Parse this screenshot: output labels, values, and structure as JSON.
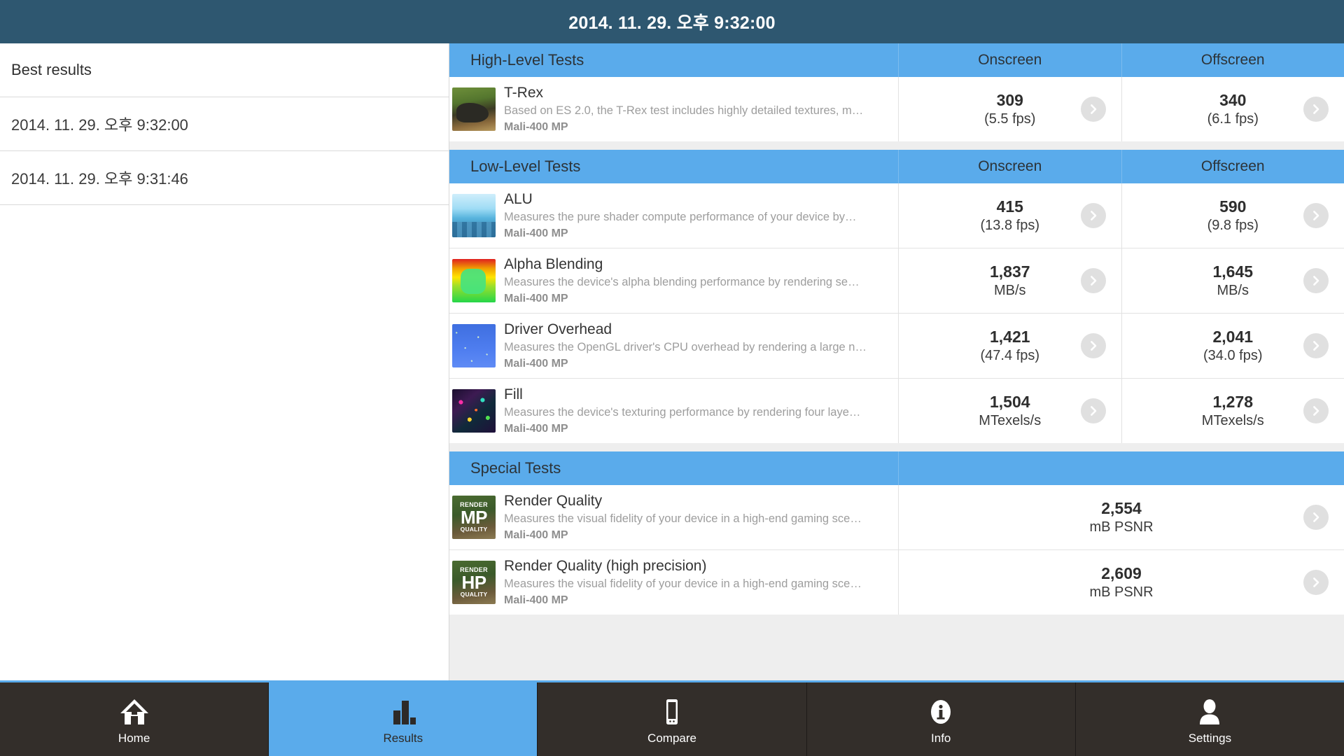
{
  "titlebar": {
    "title": "2014. 11. 29. 오후 9:32:00"
  },
  "sidebar": {
    "header": "Best results",
    "items": [
      {
        "label": "2014. 11. 29. 오후 9:32:00"
      },
      {
        "label": "2014. 11. 29. 오후 9:31:46"
      }
    ]
  },
  "columns": {
    "onscreen": "Onscreen",
    "offscreen": "Offscreen"
  },
  "sections": [
    {
      "title": "High-Level Tests",
      "rows": [
        {
          "name": "T-Rex",
          "desc": "Based on ES 2.0, the T-Rex test includes highly detailed textures, m…",
          "gpu": "Mali-400 MP",
          "thumb": "trex-thumbnail",
          "onscreen": {
            "value": "309",
            "unit": "(5.5 fps)"
          },
          "offscreen": {
            "value": "340",
            "unit": "(6.1 fps)"
          }
        }
      ]
    },
    {
      "title": "Low-Level Tests",
      "rows": [
        {
          "name": "ALU",
          "desc": "Measures the pure shader compute performance of your device by…",
          "gpu": "Mali-400 MP",
          "thumb": "alu-thumbnail",
          "onscreen": {
            "value": "415",
            "unit": "(13.8 fps)"
          },
          "offscreen": {
            "value": "590",
            "unit": "(9.8 fps)"
          }
        },
        {
          "name": "Alpha Blending",
          "desc": "Measures the device's alpha blending performance by rendering se…",
          "gpu": "Mali-400 MP",
          "thumb": "alpha-blending-thumbnail",
          "onscreen": {
            "value": "1,837",
            "unit": "MB/s"
          },
          "offscreen": {
            "value": "1,645",
            "unit": "MB/s"
          }
        },
        {
          "name": "Driver Overhead",
          "desc": "Measures the OpenGL driver's CPU overhead by rendering a large n…",
          "gpu": "Mali-400 MP",
          "thumb": "driver-overhead-thumbnail",
          "onscreen": {
            "value": "1,421",
            "unit": "(47.4 fps)"
          },
          "offscreen": {
            "value": "2,041",
            "unit": "(34.0 fps)"
          }
        },
        {
          "name": "Fill",
          "desc": "Measures the device's texturing performance by rendering four laye…",
          "gpu": "Mali-400 MP",
          "thumb": "fill-thumbnail",
          "onscreen": {
            "value": "1,504",
            "unit": "MTexels/s"
          },
          "offscreen": {
            "value": "1,278",
            "unit": "MTexels/s"
          }
        }
      ]
    },
    {
      "title": "Special Tests",
      "rows": [
        {
          "name": "Render Quality",
          "desc": "Measures the visual fidelity of your device in a high-end gaming sce…",
          "gpu": "Mali-400 MP",
          "thumb": "render-quality-mp-thumbnail",
          "badge": {
            "top": "RENDER",
            "mid": "MP",
            "bottom": "QUALITY"
          },
          "single": {
            "value": "2,554",
            "unit": "mB PSNR"
          }
        },
        {
          "name": "Render Quality (high precision)",
          "desc": "Measures the visual fidelity of your device in a high-end gaming sce…",
          "gpu": "Mali-400 MP",
          "thumb": "render-quality-hp-thumbnail",
          "badge": {
            "top": "RENDER",
            "mid": "HP",
            "bottom": "QUALITY"
          },
          "single": {
            "value": "2,609",
            "unit": "mB PSNR"
          }
        }
      ]
    }
  ],
  "navbar": {
    "items": [
      {
        "label": "Home",
        "icon": "home-icon",
        "active": false
      },
      {
        "label": "Results",
        "icon": "bar-chart-icon",
        "active": true
      },
      {
        "label": "Compare",
        "icon": "phone-icon",
        "active": false
      },
      {
        "label": "Info",
        "icon": "info-icon",
        "active": false
      },
      {
        "label": "Settings",
        "icon": "person-icon",
        "active": false
      }
    ]
  },
  "colors": {
    "titlebar": "#2e5770",
    "accent": "#5aabeb",
    "nav_bg": "#332e2a",
    "panel_bg": "#eeeeee"
  }
}
